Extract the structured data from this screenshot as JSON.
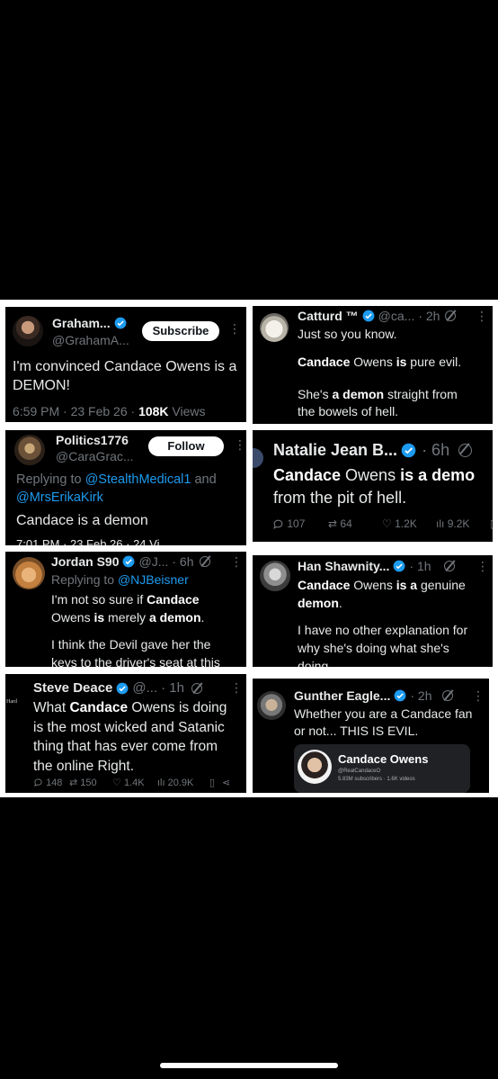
{
  "tweets": {
    "graham": {
      "name": "Graham...",
      "handle": "@GrahamA...",
      "button": "Subscribe",
      "text": "I'm convinced Candace Owens is a DEMON!",
      "meta_time": "6:59 PM · 23 Feb 26 · ",
      "meta_views_num": "108K",
      "meta_views_label": " Views"
    },
    "catturd": {
      "name": "Catturd ™",
      "handle": "@ca...",
      "time": "· 2h",
      "line1": "Just so you know.",
      "line2_bold": "Candace",
      "line2_mid": " Owens ",
      "line2_bold2": "is",
      "line2_end": " pure evil.",
      "line3_a": "She's ",
      "line3_bold": "a demon",
      "line3_b": " straight from",
      "line4": "the bowels of hell."
    },
    "politics": {
      "name": "Politics1776",
      "handle": "@CaraGrac...",
      "button": "Follow",
      "replying": "Replying to ",
      "mention1": "@StealthMedical1",
      "and": " and",
      "mention2": "@MrsErikaKirk",
      "text": "Candace is a demon",
      "cut_meta": "7:01 PM · 23 Feb 26 · 24 Vi"
    },
    "natalie": {
      "name": "Natalie Jean B...",
      "time": "· 6h",
      "line1_bold": "Candace",
      "line1_mid": " Owens ",
      "line1_bold2": "is a demo",
      "line2": "from the pit of hell.",
      "replies": "107",
      "retweets": "64",
      "likes": "1.2K",
      "views": "9.2K"
    },
    "jordan": {
      "name": "Jordan S90",
      "handle": "@J...",
      "time": "· 6h",
      "replying": "Replying to ",
      "mention": "@NJBeisner",
      "line1_a": "I'm not so sure if ",
      "line1_bold": "Candace",
      "line2_a": "Owens ",
      "line2_bold": "is",
      "line2_b": " merely ",
      "line2_bold2": "a demon",
      "line2_c": ".",
      "line3": "I think the Devil gave her the",
      "line4": "keys to the driver's seat at this"
    },
    "han": {
      "name": "Han Shawnity...",
      "time": "· 1h",
      "line1_bold": "Candace",
      "line1_mid": " Owens ",
      "line1_bold2": "is a",
      "line1_end": " genuine",
      "line2_bold": "demon",
      "line2_end": ".",
      "line3": "I have no other explanation for",
      "line4": "why she's doing what she's",
      "line5": "doing."
    },
    "steve": {
      "side_label": "Hard",
      "name": "Steve Deace",
      "handle": "@...",
      "time": "· 1h",
      "line1_a": "What ",
      "line1_bold": "Candace",
      "line1_b": " Owens is doing",
      "line2": "is the most wicked and Satanic",
      "line3": "thing that has ever come from",
      "line4": "the online Right.",
      "replies": "148",
      "retweets": "150",
      "likes": "1.4K",
      "views": "20.9K"
    },
    "gunther": {
      "name": "Gunther Eagle...",
      "time": "· 2h",
      "line1": "Whether you are a Candace fan",
      "line2": "or not... THIS IS EVIL.",
      "embed_title": "Candace Owens",
      "embed_handle": "@RealCandaceO",
      "embed_stats": "5.83M subscribers · 1.6K videos"
    }
  },
  "colors": {
    "background": "#000000",
    "text": "#e7e9ea",
    "muted": "#71767b",
    "link": "#1d9bf0",
    "verified": "#1d9bf0",
    "separator": "#ffffff"
  }
}
